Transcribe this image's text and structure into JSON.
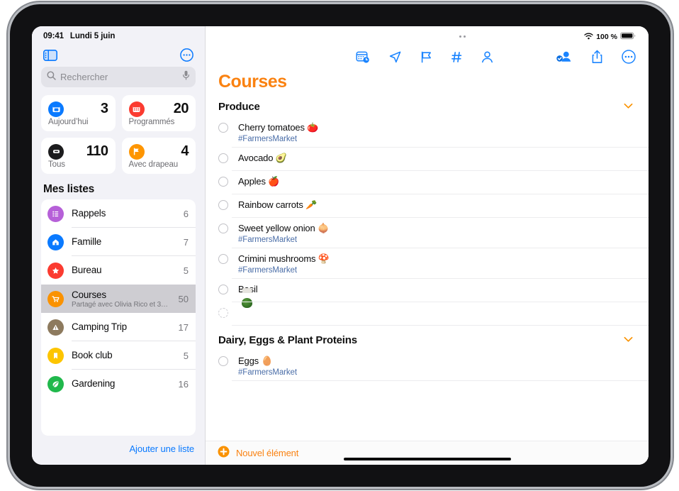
{
  "status_bar": {
    "time": "09:41",
    "date": "Lundi 5 juin",
    "battery_pct": "100 %",
    "wifi_icon": "wifi-icon",
    "battery_icon": "battery-icon"
  },
  "sidebar": {
    "toggle_icon": "sidebar-toggle-icon",
    "more_icon": "more-circle-icon",
    "search": {
      "placeholder": "Rechercher",
      "search_icon": "search-icon",
      "mic_icon": "microphone-icon"
    },
    "smart_lists": [
      {
        "label": "Aujourd’hui",
        "count": "3",
        "icon": "today-calendar-icon",
        "color": "#0a7aff"
      },
      {
        "label": "Programmés",
        "count": "20",
        "icon": "scheduled-calendar-icon",
        "color": "#fb3b30"
      },
      {
        "label": "Tous",
        "count": "110",
        "icon": "all-inbox-icon",
        "color": "#1c1c1e"
      },
      {
        "label": "Avec drapeau",
        "count": "4",
        "icon": "flag-icon",
        "color": "#fe9500"
      }
    ],
    "my_lists_title": "Mes listes",
    "lists": [
      {
        "name": "Rappels",
        "count": "6",
        "icon": "list-bullet-icon",
        "color": "#b660d8",
        "subtitle": "",
        "selected": false
      },
      {
        "name": "Famille",
        "count": "7",
        "icon": "house-icon",
        "color": "#0a7aff",
        "subtitle": "",
        "selected": false
      },
      {
        "name": "Bureau",
        "count": "5",
        "icon": "star-icon",
        "color": "#fb3b30",
        "subtitle": "",
        "selected": false
      },
      {
        "name": "Courses",
        "count": "50",
        "icon": "cart-icon",
        "color": "#fa9200",
        "subtitle": "Partagé avec Olivia Rico et 3…",
        "selected": true
      },
      {
        "name": "Camping Trip",
        "count": "17",
        "icon": "triangle-warning-icon",
        "color": "#8d7a5e",
        "subtitle": "",
        "selected": false
      },
      {
        "name": "Book club",
        "count": "5",
        "icon": "bookmark-icon",
        "color": "#fdc500",
        "subtitle": "",
        "selected": false
      },
      {
        "name": "Gardening",
        "count": "16",
        "icon": "leaf-icon",
        "color": "#20b84c",
        "subtitle": "",
        "selected": false
      }
    ],
    "add_list_label": "Ajouter une liste"
  },
  "main": {
    "title": "Courses",
    "title_color": "#fa8211",
    "toolbar_left": [
      "calendar-clock-icon",
      "location-arrow-icon",
      "flag-icon",
      "hashtag-icon",
      "person-icon"
    ],
    "toolbar_right": [
      "shared-person-badge-icon",
      "share-icon",
      "more-circle-icon"
    ],
    "sections": [
      {
        "title": "Produce",
        "chevron_icon": "chevron-down-icon",
        "items": [
          {
            "title": "Cherry tomatoes 🍅",
            "tag": "#FarmersMarket",
            "thumb": false,
            "placeholder": false
          },
          {
            "title": "Avocado 🥑",
            "tag": "",
            "thumb": false,
            "placeholder": false
          },
          {
            "title": "Apples 🍎",
            "tag": "",
            "thumb": false,
            "placeholder": false
          },
          {
            "title": "Rainbow carrots 🥕",
            "tag": "",
            "thumb": false,
            "placeholder": false
          },
          {
            "title": "Sweet yellow onion 🧅",
            "tag": "#FarmersMarket",
            "thumb": false,
            "placeholder": false
          },
          {
            "title": "Crimini mushrooms 🍄",
            "tag": "#FarmersMarket",
            "thumb": false,
            "placeholder": false
          },
          {
            "title": "Basil",
            "tag": "",
            "thumb": true,
            "placeholder": false
          },
          {
            "title": "",
            "tag": "",
            "thumb": false,
            "placeholder": true
          }
        ]
      },
      {
        "title": "Dairy, Eggs & Plant Proteins",
        "chevron_icon": "chevron-down-icon",
        "items": [
          {
            "title": "Eggs 🥚",
            "tag": "#FarmersMarket",
            "thumb": false,
            "placeholder": false
          }
        ]
      }
    ],
    "new_item": {
      "label": "Nouvel élément",
      "icon": "plus-circle-icon"
    }
  }
}
